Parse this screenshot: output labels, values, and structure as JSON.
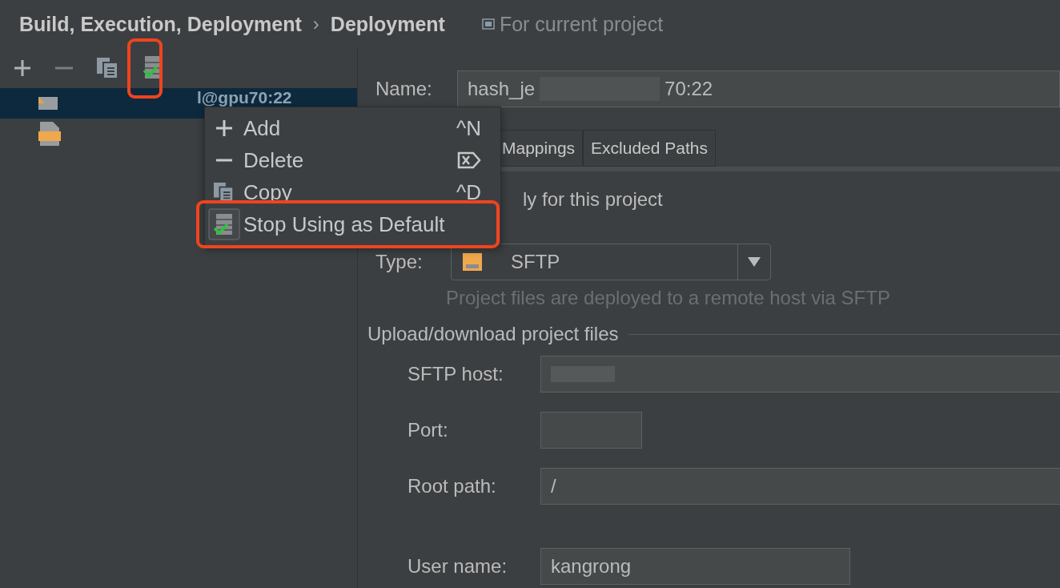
{
  "breadcrumb": {
    "section": "Build, Execution, Deployment",
    "separator": "›",
    "page": "Deployment",
    "scope": "For current project"
  },
  "tree": {
    "items": [
      {
        "label": "l@gpu70:22",
        "kind": "server",
        "selected": true
      },
      {
        "kind": "sftp",
        "selected": false
      }
    ]
  },
  "context_menu": {
    "items": [
      {
        "label": "Add",
        "shortcut": "^N",
        "kind": "add"
      },
      {
        "label": "Delete",
        "kind": "delete"
      },
      {
        "label": "Copy",
        "shortcut": "^D",
        "kind": "copy"
      },
      {
        "label": "Stop Using as Default",
        "kind": "default"
      }
    ]
  },
  "form": {
    "name_label": "Name:",
    "name_value": "hash_je",
    "name_value_end": "70:22",
    "tabs": [
      {
        "label": "Mappings",
        "selected": false
      },
      {
        "label": "Excluded Paths",
        "selected": false
      }
    ],
    "visible_label": "ly for this project",
    "type_label": "Type:",
    "type_value": "SFTP",
    "hint": "Project files are deployed to a remote host via SFTP",
    "section": "Upload/download project files",
    "host_label": "SFTP host:",
    "port_label": "Port:",
    "root_label": "Root path:",
    "root_value": "/",
    "user_label": "User name:",
    "user_value": "kangrong"
  }
}
